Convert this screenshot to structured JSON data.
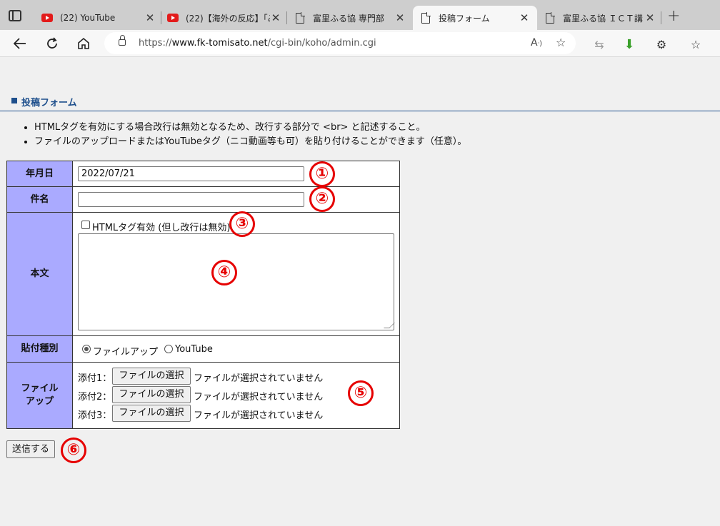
{
  "browser": {
    "tabs": [
      {
        "title": "(22) YouTube",
        "icon": "youtube-icon"
      },
      {
        "title": "(22)【海外の反応】｢み",
        "icon": "youtube-icon"
      },
      {
        "title": "富里ふる協 専門部",
        "icon": "page-icon"
      },
      {
        "title": "投稿フォーム",
        "icon": "page-icon"
      },
      {
        "title": "富里ふる協 ＩＣＴ講",
        "icon": "page-icon"
      }
    ],
    "url": {
      "scheme": "https://",
      "domain": "www.fk-tomisato.net",
      "path": "/cgi-bin/koho/admin.cgi"
    },
    "read_aloud_label": "A))"
  },
  "page": {
    "heading": "投稿フォーム",
    "notes": [
      "HTMLタグを有効にする場合改行は無効となるため、改行する部分で <br> と記述すること。",
      "ファイルのアップロードまたはYouTubeタグ（ニコ動画等も可）を貼り付けることができます（任意）。"
    ]
  },
  "form": {
    "date_label": "年月日",
    "date_value": "2022/07/21",
    "subject_label": "件名",
    "subject_value": "",
    "body_label": "本文",
    "html_checkbox_label": "HTMLタグ有効 (但し改行は無効)",
    "attach_type_label": "貼付種別",
    "attach_options": [
      "ファイルアップ",
      "YouTube"
    ],
    "file_label_line1": "ファイル",
    "file_label_line2": "アップ",
    "files": [
      {
        "label": "添付1：",
        "button": "ファイルの選択",
        "status": "ファイルが選択されていません"
      },
      {
        "label": "添付2：",
        "button": "ファイルの選択",
        "status": "ファイルが選択されていません"
      },
      {
        "label": "添付3：",
        "button": "ファイルの選択",
        "status": "ファイルが選択されていません"
      }
    ],
    "submit_label": "送信する"
  },
  "annotations": [
    "①",
    "②",
    "③",
    "④",
    "⑤",
    "⑥"
  ],
  "colors": {
    "label_bg": "#aaaaff",
    "heading": "#1e4f8c",
    "marker": "#e60000"
  }
}
